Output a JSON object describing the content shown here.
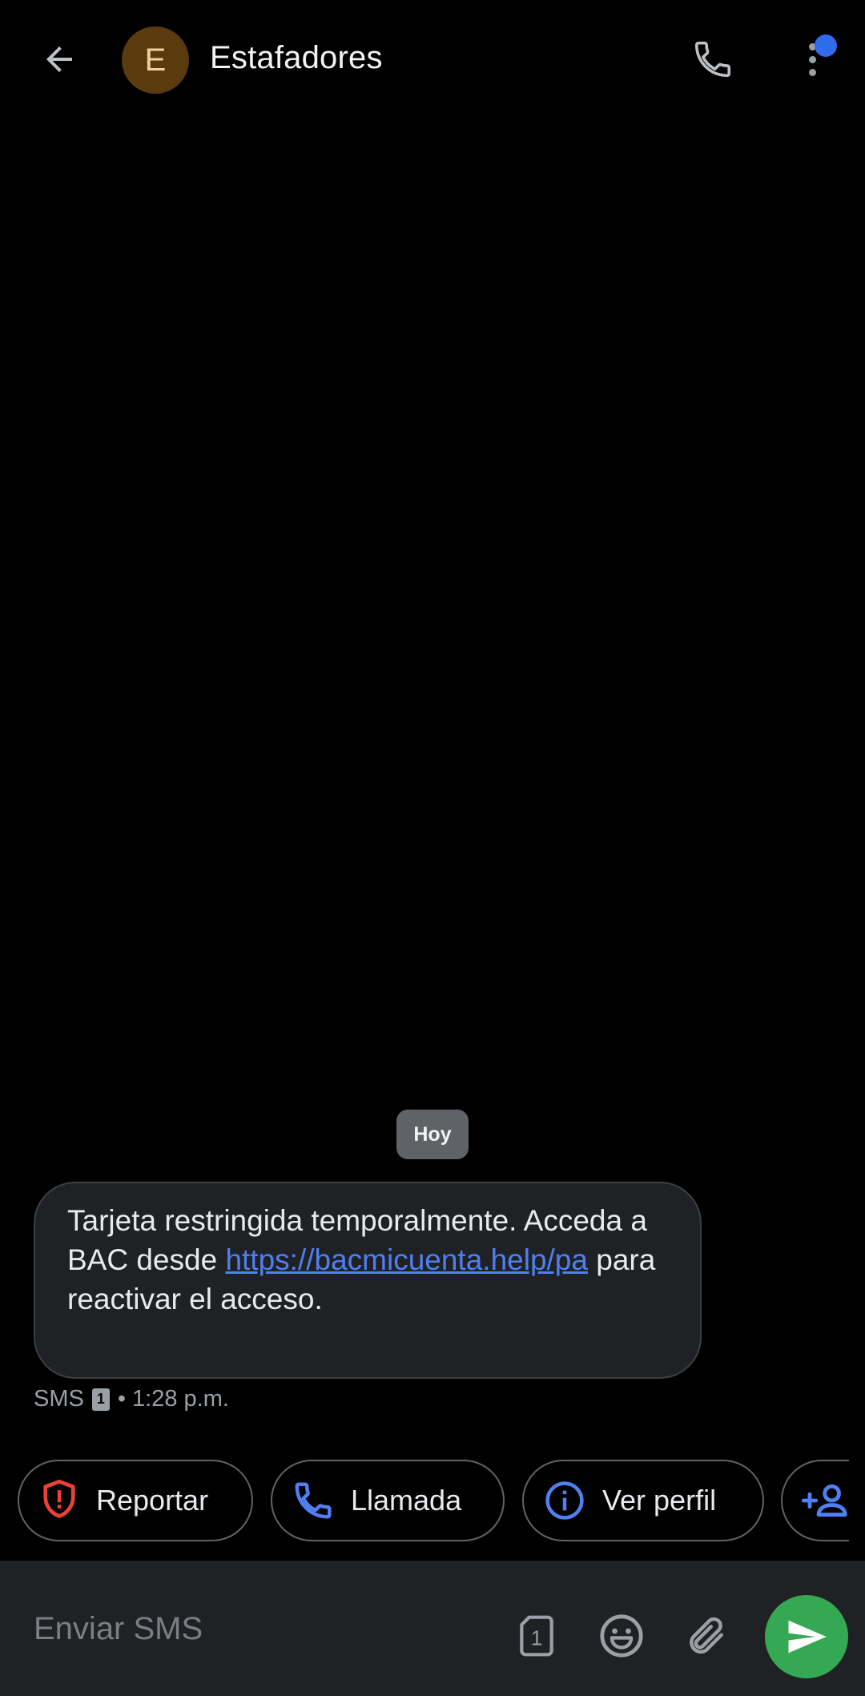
{
  "header": {
    "contact_name": "Estafadores",
    "avatar_initial": "E",
    "icons": {
      "back": "arrow-left-icon",
      "call": "phone-icon",
      "more": "more-vertical-icon"
    },
    "notification_color": "#2f6bea"
  },
  "conversation": {
    "date_chip": "Hoy",
    "messages": [
      {
        "text_before": "Tarjeta restringida temporalmente. Acceda a BAC desde ",
        "link": "https://bacmicuenta.help/pa",
        "text_after": " para reactivar el acceso.",
        "type": "SMS",
        "sim": "1",
        "time": "• 1:28 p.m."
      }
    ]
  },
  "suggestions": [
    {
      "label": "Reportar",
      "icon": "shield-alert-icon",
      "color": "#ea4335"
    },
    {
      "label": "Llamada",
      "icon": "phone-icon",
      "color": "#4f7ff0"
    },
    {
      "label": "Ver perfil",
      "icon": "info-icon",
      "color": "#4f7ff0"
    },
    {
      "label": "",
      "icon": "add-person-icon",
      "color": "#4f7ff0"
    }
  ],
  "composer": {
    "placeholder": "Enviar SMS",
    "sim_label": "1",
    "icons": {
      "sim": "sim-card-icon",
      "emoji": "emoji-icon",
      "attach": "paperclip-icon",
      "send": "send-icon"
    },
    "send_color": "#35a853"
  }
}
